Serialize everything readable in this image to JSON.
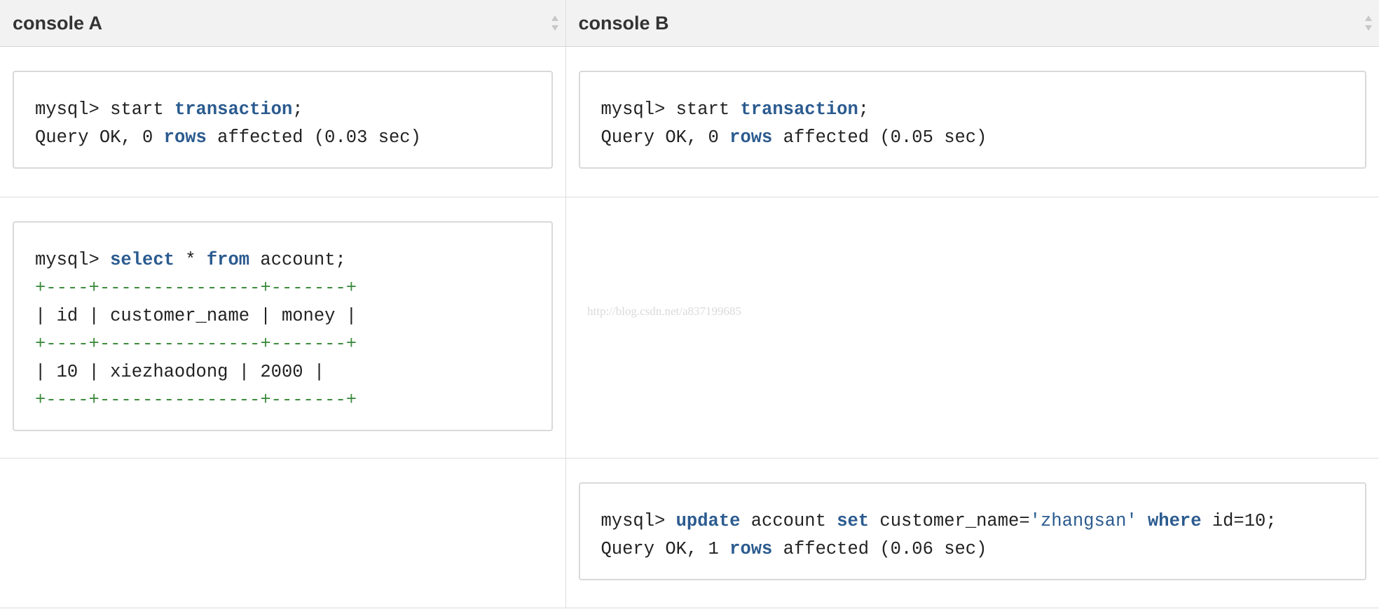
{
  "headers": {
    "console_a": "console A",
    "console_b": "console B"
  },
  "colors": {
    "keyword": "#2b5b8f",
    "table_border": "#3f8a3f",
    "header_bg": "#f2f2f2"
  },
  "row1": {
    "a": {
      "line1": {
        "prompt": "mysql> ",
        "w1": "start ",
        "kw1": "transaction",
        "end": ";"
      },
      "line2": {
        "pre": "Query OK, 0 ",
        "kw": "rows",
        "post": " affected (0.03 sec)"
      }
    },
    "b": {
      "line1": {
        "prompt": "mysql> ",
        "w1": "start ",
        "kw1": "transaction",
        "end": ";"
      },
      "line2": {
        "pre": "Query OK, 0 ",
        "kw": "rows",
        "post": " affected (0.05 sec)"
      }
    }
  },
  "row2": {
    "a": {
      "line1": {
        "prompt": "mysql> ",
        "kw1": "select",
        "mid": " * ",
        "kw2": "from",
        "post": " account;"
      },
      "border": "+----+---------------+-------+",
      "header_row": "| id | customer_name | money |",
      "data_row": "| 10 | xiezhaodong | 2000 |"
    },
    "watermark": "http://blog.csdn.net/a837199685"
  },
  "row3": {
    "b": {
      "line1": {
        "prompt": "mysql> ",
        "kw1": "update",
        "p1": " account ",
        "kw2": "set",
        "p2": " customer_name=",
        "str": "'zhangsan'",
        "p3": " ",
        "kw3": "where",
        "p4": " id=10;"
      },
      "line2": {
        "pre": "Query OK, 1 ",
        "kw": "rows",
        "post": " affected (0.06 sec)"
      }
    }
  }
}
